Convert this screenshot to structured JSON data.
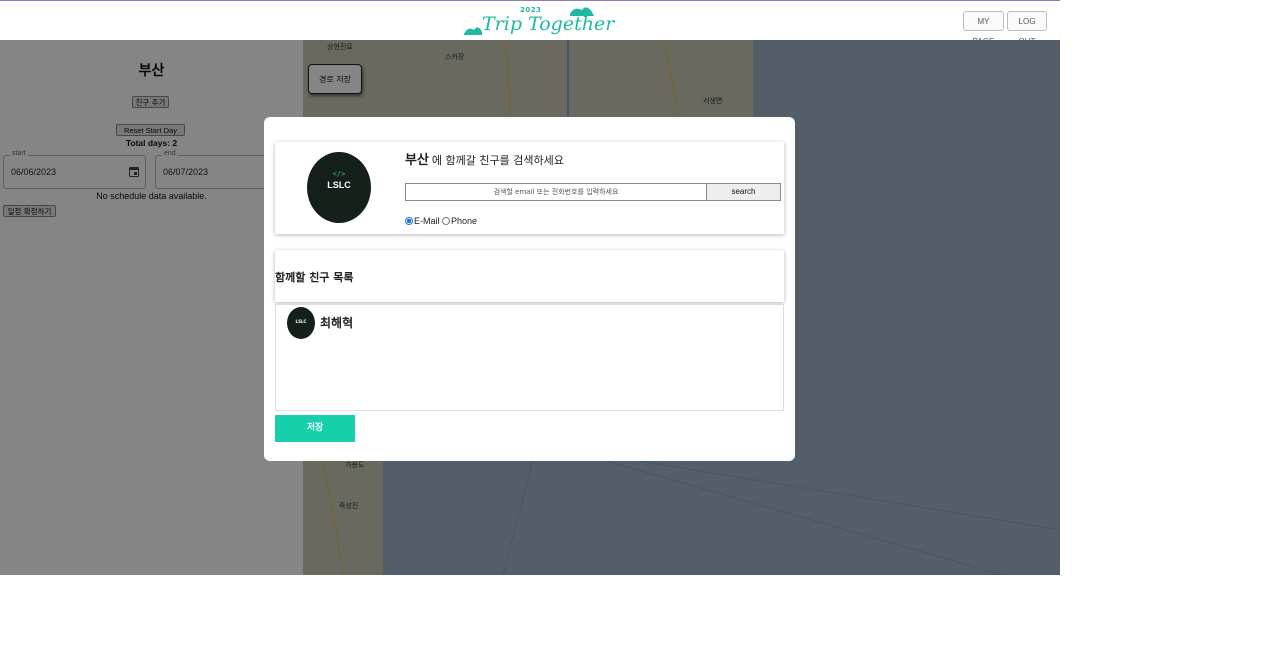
{
  "header": {
    "logo_year": "2023",
    "logo_name": "Trip Together",
    "my_page": "MY PAGE",
    "log_out": "LOG OUT"
  },
  "sidebar": {
    "city": "부산",
    "add_friend": "친구 추가",
    "reset_start_day": "Reset Start Day",
    "total_days": "Total days: 2",
    "start_label": "start",
    "start_value": "06/06/2023",
    "end_label": "end",
    "end_value": "06/07/2023",
    "no_schedule": "No schedule data available.",
    "confirm_schedule": "일정 확정하기"
  },
  "map": {
    "save_route": "경로 저장",
    "labels": [
      "상현진료",
      "스카장",
      "서생면",
      "가용도",
      "죽성진"
    ]
  },
  "modal": {
    "city": "부산",
    "title_rest": "에 함께갈 친구를 검색하세요",
    "avatar_text": "LSLC",
    "search_placeholder": "검색할 email 또는 전화번호를 입력하세요",
    "search_button": "search",
    "radio_email": "E-Mail",
    "radio_phone": "Phone",
    "selected_radio": "E-Mail",
    "list_title": "함께할 친구 목록",
    "friends": [
      {
        "name": "최해혁",
        "avatar_text": "LSLC"
      }
    ],
    "save_button": "저장"
  },
  "colors": {
    "brand": "#1fb8a0",
    "save_button": "#16d0ab",
    "overlay": "rgba(0,0,0,0.48)"
  }
}
